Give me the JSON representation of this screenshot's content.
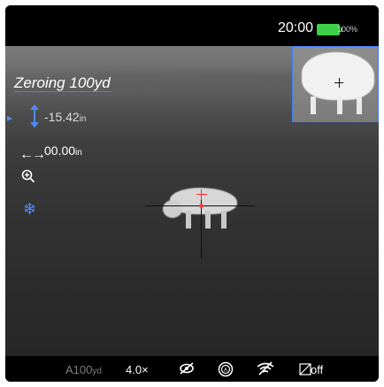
{
  "status": {
    "time": "20:00",
    "battery_percent": "100%",
    "battery_level": 1.0,
    "battery_color": "#3fd04a"
  },
  "overlay": {
    "zeroing_title": "Zeroing 100yd",
    "vertical": {
      "value": "-15.42",
      "unit": "in"
    },
    "horizontal": {
      "value": "00.00",
      "unit": "in"
    },
    "icons": {
      "vertical": "vertical-adjust-icon",
      "horizontal": "horizontal-adjust-icon",
      "zoom": "zoom-in-icon",
      "freeze": "snowflake-icon",
      "side_arrow": "chevron-right-icon"
    },
    "accent_color": "#4f8cff"
  },
  "pip": {
    "label": "picture-in-picture"
  },
  "bottom": {
    "range": "A100",
    "range_unit": "yd",
    "zoom": "4.0×",
    "rec_label": "off",
    "icons": {
      "eye": "eye-off-icon",
      "auto": "a-mode-icon",
      "wifi": "wifi-off-icon",
      "rec": "recording-off-icon"
    }
  }
}
